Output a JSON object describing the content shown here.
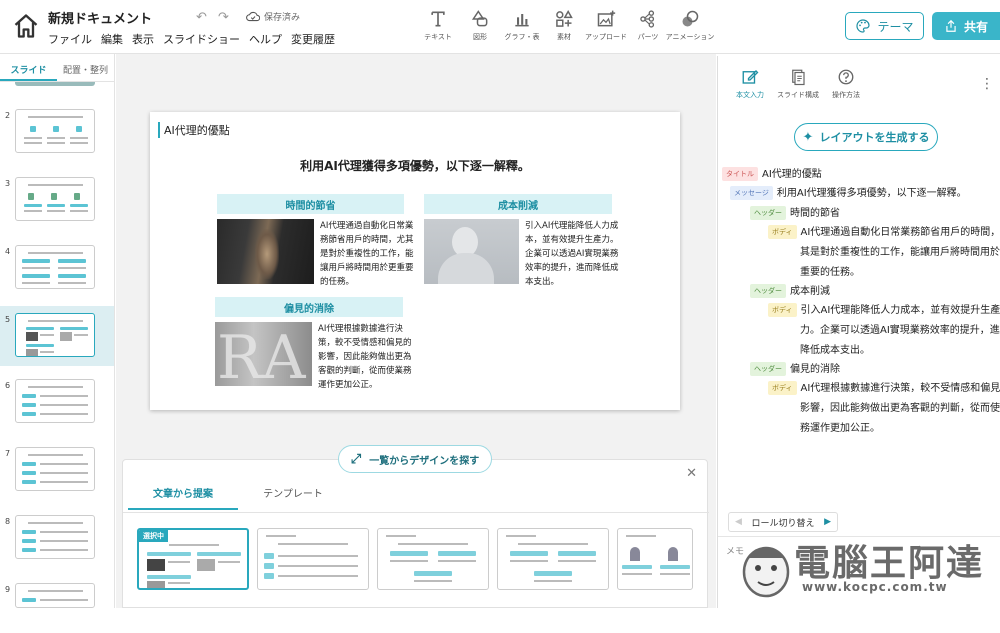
{
  "app": {
    "doc_title": "新規ドキュメント",
    "menus": [
      "ファイル",
      "編集",
      "表示",
      "スライドショー",
      "ヘルプ",
      "変更履歴"
    ],
    "saved_label": "保存済み"
  },
  "toolbar": {
    "tools": [
      {
        "label": "テキスト",
        "icon": "text-icon"
      },
      {
        "label": "図形",
        "icon": "shape-icon"
      },
      {
        "label": "グラフ・表",
        "icon": "chart-icon"
      },
      {
        "label": "素材",
        "icon": "material-icon"
      },
      {
        "label": "アップロード",
        "icon": "upload-icon"
      },
      {
        "label": "パーツ",
        "icon": "parts-icon"
      },
      {
        "label": "アニメーション",
        "icon": "animation-icon"
      }
    ],
    "theme_label": "テーマ",
    "share_label": "共有"
  },
  "left_panel": {
    "tabs": [
      "スライド",
      "配置・整列"
    ],
    "slide_numbers": [
      "2",
      "3",
      "4",
      "5",
      "6",
      "7",
      "8",
      "9"
    ]
  },
  "slide": {
    "title": "AI代理的優點",
    "message": "利用AI代理獲得多項優勢，以下逐一解釋。",
    "blocks": [
      {
        "header": "時間的節省",
        "body": "AI代理通過自動化日常業務節省用戶的時間，尤其是對於重複性的工作，能讓用戶將時間用於更重要的任務。"
      },
      {
        "header": "成本削減",
        "body": "引入AI代理能降低人力成本，並有效提升生產力。企業可以透過AI實現業務效率的提升，進而降低成本支出。"
      },
      {
        "header": "偏見的消除",
        "body": "AI代理根據數據進行決策，較不受情感和偏見的影響，因此能夠做出更為客觀的判斷，從而使業務運作更加公正。"
      }
    ]
  },
  "bottom_panel": {
    "explore_label": "一覧からデザインを探す",
    "tabs": [
      "文章から提案",
      "テンプレート"
    ],
    "selected_badge": "選択中"
  },
  "right_panel": {
    "tabs": [
      "本文入力",
      "スライド構成",
      "操作方法"
    ],
    "generate_label": "レイアウトを生成する",
    "tags": {
      "title": "タイトル",
      "message": "メッセージ",
      "header": "ヘッダー",
      "body": "ボディ"
    },
    "outline": {
      "title": "AI代理的優點",
      "message": "利用AI代理獲得多項優勢，以下逐一解釋。",
      "h1": "時間的節省",
      "b1": [
        "AI代理通過自動化日常業務節省用戶的時間，尤",
        "其是對於重複性的工作，能讓用戶將時間用於更",
        "重要的任務。"
      ],
      "h2": "成本削減",
      "b2": [
        "引入AI代理能降低人力成本，並有效提升生產",
        "力。企業可以透過AI實現業務效率的提升，進而",
        "降低成本支出。"
      ],
      "h3": "偏見的消除",
      "b3": [
        "AI代理根據數據進行決策，較不受情感和偏見的",
        "影響，因此能夠做出更為客觀的判斷，從而使業",
        "務運作更加公正。"
      ]
    },
    "role_switch_label": "ロール切り替え",
    "memo_label": "メモ"
  },
  "watermark": {
    "text": "電腦王阿達",
    "url": "www.kocpc.com.tw"
  },
  "colors": {
    "accent": "#29a8bd",
    "accent_light": "#d8f2f5",
    "share_bg": "#3ab5c9"
  }
}
